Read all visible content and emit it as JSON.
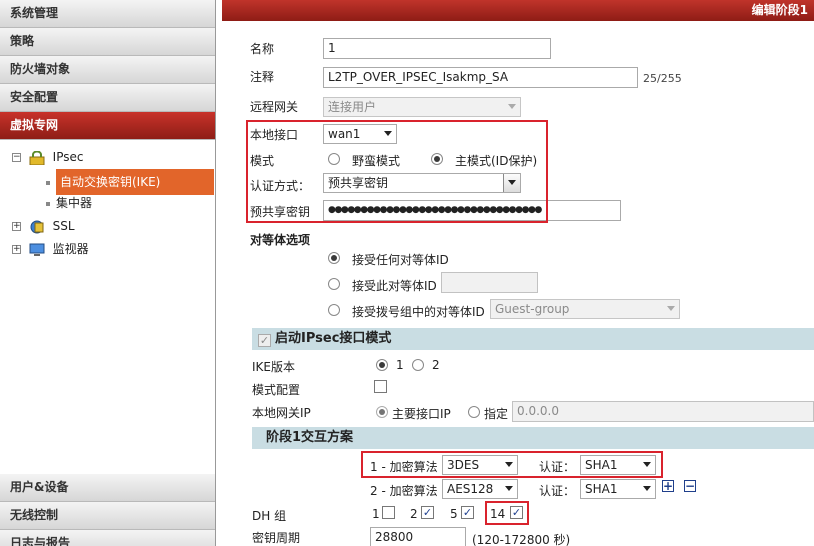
{
  "sidebar": {
    "top_menu": [
      "系统管理",
      "策略",
      "防火墙对象",
      "安全配置",
      "虚拟专网"
    ],
    "active_index": 4,
    "tree": {
      "ipsec": "IPsec",
      "ike": "自动交换密钥(IKE)",
      "concentrator": "集中器",
      "ssl": "SSL",
      "monitor": "监视器"
    },
    "bottom_menu": [
      "用户&设备",
      "无线控制",
      "日志与报告"
    ]
  },
  "header": {
    "title": "编辑阶段1"
  },
  "form": {
    "name_label": "名称",
    "name_value": "1",
    "comment_label": "注释",
    "comment_value": "L2TP_OVER_IPSEC_Isakmp_SA",
    "comment_count": "25/255",
    "remote_gw_label": "远程网关",
    "remote_gw_value": "连接用户",
    "local_if_label": "本地接口",
    "local_if_value": "wan1",
    "mode_label": "模式",
    "mode_aggressive": "野蛮模式",
    "mode_main": "主模式(ID保护)",
    "auth_label": "认证方式：",
    "auth_value": "预共享密钥",
    "psk_label": "预共享密钥",
    "psk_value": "●●●●●●●●●●●●●●●●●●●●●●●●●●●●●●●●●",
    "peer_label": "对等体选项",
    "peer_any": "接受任何对等体ID",
    "peer_this": "接受此对等体ID",
    "peer_dialup": "接受拨号组中的对等体ID",
    "peer_group_value": "Guest-group"
  },
  "ipsec_section": {
    "title": "启动IPsec接口模式",
    "ike_version_label": "IKE版本",
    "ike_v1": "1",
    "ike_v2": "2",
    "mode_config_label": "模式配置",
    "local_gw_label": "本地网关IP",
    "local_gw_primary": "主要接口IP",
    "local_gw_specify": "指定",
    "local_gw_ip": "0.0.0.0"
  },
  "proposal": {
    "title": "阶段1交互方案",
    "row1_label": "1 - 加密算法",
    "row1_enc": "3DES",
    "row1_auth_label": "认证：",
    "row1_auth": "SHA1",
    "row2_label": "2 - 加密算法",
    "row2_enc": "AES128",
    "row2_auth_label": "认证：",
    "row2_auth": "SHA1",
    "add": "+",
    "remove": "−",
    "dh_label": "DH 组",
    "dh": [
      {
        "label": "1",
        "checked": false
      },
      {
        "label": "2",
        "checked": true
      },
      {
        "label": "5",
        "checked": true
      },
      {
        "label": "14",
        "checked": true
      }
    ],
    "keylife_label": "密钥周期",
    "keylife_value": "28800",
    "keylife_range": "(120-172800 秒)"
  }
}
